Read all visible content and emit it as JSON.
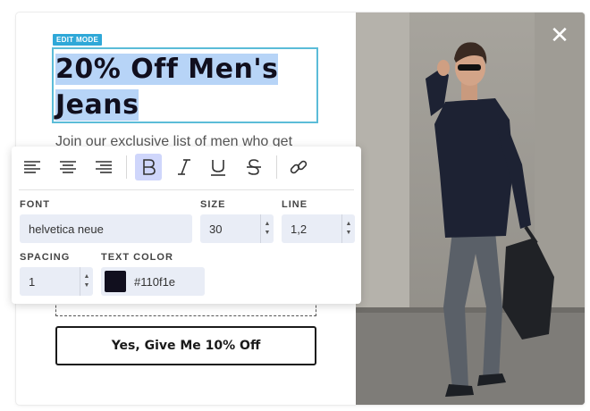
{
  "editor": {
    "badge": "EDIT MODE",
    "headline_line1": "20% Off Men's",
    "headline_line2": "Jeans",
    "body_text": "Join our exclusive list of men who get",
    "cta_label": "Yes, Give Me 10% Off"
  },
  "toolbar": {
    "font_label": "FONT",
    "font_value": "helvetica neue",
    "size_label": "SIZE",
    "size_value": "30",
    "line_label": "LINE",
    "line_value": "1,2",
    "spacing_label": "SPACING",
    "spacing_value": "1",
    "text_color_label": "TEXT COLOR",
    "text_color_value": "#110f1e"
  },
  "icons": {
    "align_left": "align-left-icon",
    "align_center": "align-center-icon",
    "align_right": "align-right-icon",
    "bold": "bold-icon",
    "italic": "italic-icon",
    "underline": "underline-icon",
    "strikethrough": "strikethrough-icon",
    "link": "link-icon",
    "close": "close-icon"
  },
  "colors": {
    "text_color": "#110f1e",
    "accent": "#2fa8d8",
    "bold_active": "#cfd6fb",
    "selection": "#b7d4f7"
  }
}
